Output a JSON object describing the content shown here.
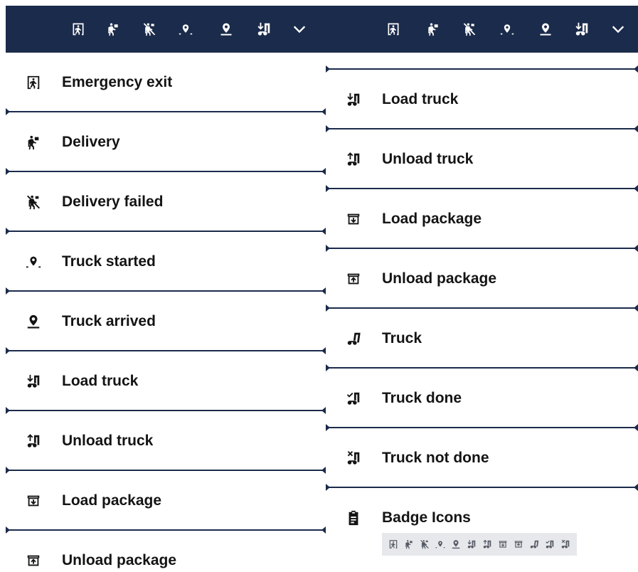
{
  "icons": {
    "emergency_exit": "emergency-exit-icon",
    "delivery": "delivery-icon",
    "delivery_failed": "delivery-failed-icon",
    "truck_started": "truck-started-icon",
    "truck_arrived": "truck-arrived-icon",
    "load_truck": "load-truck-icon",
    "unload_truck": "unload-truck-icon",
    "load_package": "load-package-icon",
    "unload_package": "unload-package-icon",
    "truck": "truck-icon",
    "truck_done": "truck-done-icon",
    "truck_not_done": "truck-not-done-icon",
    "clipboard": "clipboard-icon",
    "chevron": "chevron-down-icon"
  },
  "colors": {
    "toolbar": "#1b2b4b",
    "icon_on_toolbar": "#ffffff",
    "icon_on_list": "#141414",
    "badge_bg": "#e6e8ec",
    "divider": "#1b2b4b"
  },
  "left_list": {
    "items": [
      {
        "label": "Emergency exit",
        "icon": "emergency_exit"
      },
      {
        "label": "Delivery",
        "icon": "delivery"
      },
      {
        "label": "Delivery failed",
        "icon": "delivery_failed"
      },
      {
        "label": "Truck started",
        "icon": "truck_started"
      },
      {
        "label": "Truck arrived",
        "icon": "truck_arrived"
      },
      {
        "label": "Load truck",
        "icon": "load_truck"
      },
      {
        "label": "Unload truck",
        "icon": "unload_truck"
      },
      {
        "label": "Load package",
        "icon": "load_package"
      },
      {
        "label": "Unload package",
        "icon": "unload_package"
      }
    ]
  },
  "right_list": {
    "items": [
      {
        "label": "Load truck",
        "icon": "load_truck"
      },
      {
        "label": "Unload truck",
        "icon": "unload_truck"
      },
      {
        "label": "Load package",
        "icon": "load_package"
      },
      {
        "label": "Unload package",
        "icon": "unload_package"
      },
      {
        "label": "Truck",
        "icon": "truck"
      },
      {
        "label": "Truck done",
        "icon": "truck_done"
      },
      {
        "label": "Truck not done",
        "icon": "truck_not_done"
      },
      {
        "label": "Badge Icons",
        "icon": "clipboard"
      }
    ]
  }
}
